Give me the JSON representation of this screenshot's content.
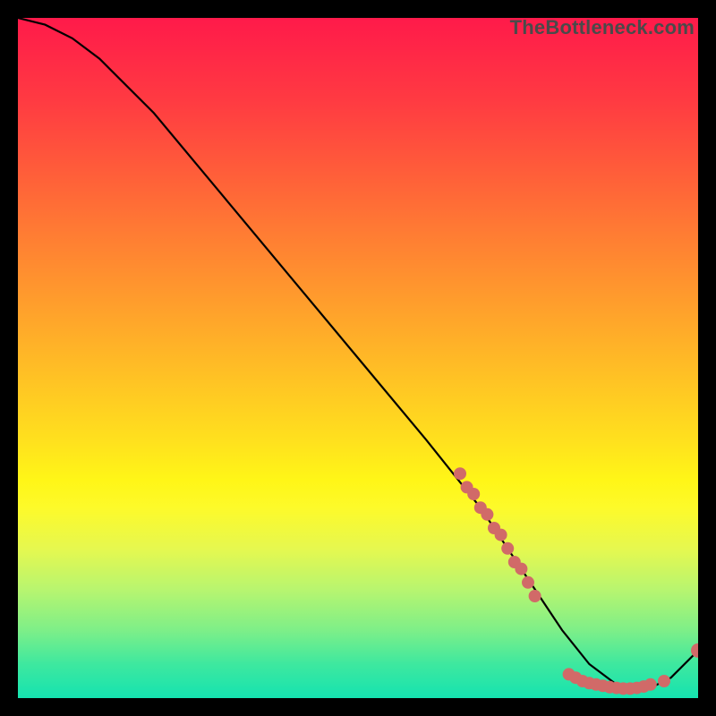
{
  "watermark": "TheBottleneck.com",
  "chart_data": {
    "type": "line",
    "title": "",
    "xlabel": "",
    "ylabel": "",
    "xlim": [
      0,
      100
    ],
    "ylim": [
      0,
      100
    ],
    "grid": false,
    "legend": false,
    "series": [
      {
        "name": "curve",
        "color": "#000000",
        "x": [
          0,
          4,
          8,
          12,
          20,
          30,
          40,
          50,
          60,
          68,
          72,
          76,
          80,
          84,
          88,
          92,
          96,
          100
        ],
        "y": [
          100,
          99,
          97,
          94,
          86,
          74,
          62,
          50,
          38,
          28,
          22,
          16,
          10,
          5,
          2,
          1,
          3,
          7
        ]
      }
    ],
    "markers": [
      {
        "name": "dot-cluster-upper",
        "color": "#d16a68",
        "radius": 7,
        "points": [
          [
            65,
            33
          ],
          [
            66,
            31
          ],
          [
            67,
            30
          ],
          [
            68,
            28
          ],
          [
            69,
            27
          ],
          [
            70,
            25
          ],
          [
            71,
            24
          ],
          [
            72,
            22
          ],
          [
            73,
            20
          ],
          [
            74,
            19
          ],
          [
            75,
            17
          ],
          [
            76,
            15
          ]
        ]
      },
      {
        "name": "dot-cluster-lower",
        "color": "#d16a68",
        "radius": 7,
        "points": [
          [
            81,
            3.5
          ],
          [
            82,
            3
          ],
          [
            83,
            2.5
          ],
          [
            84,
            2.2
          ],
          [
            85,
            2
          ],
          [
            86,
            1.8
          ],
          [
            87,
            1.6
          ],
          [
            88,
            1.5
          ],
          [
            89,
            1.4
          ],
          [
            90,
            1.4
          ],
          [
            91,
            1.5
          ],
          [
            92,
            1.7
          ],
          [
            93,
            2.0
          ],
          [
            95,
            2.5
          ]
        ]
      },
      {
        "name": "dot-end",
        "color": "#d16a68",
        "radius": 8,
        "points": [
          [
            100,
            7
          ]
        ]
      }
    ]
  }
}
